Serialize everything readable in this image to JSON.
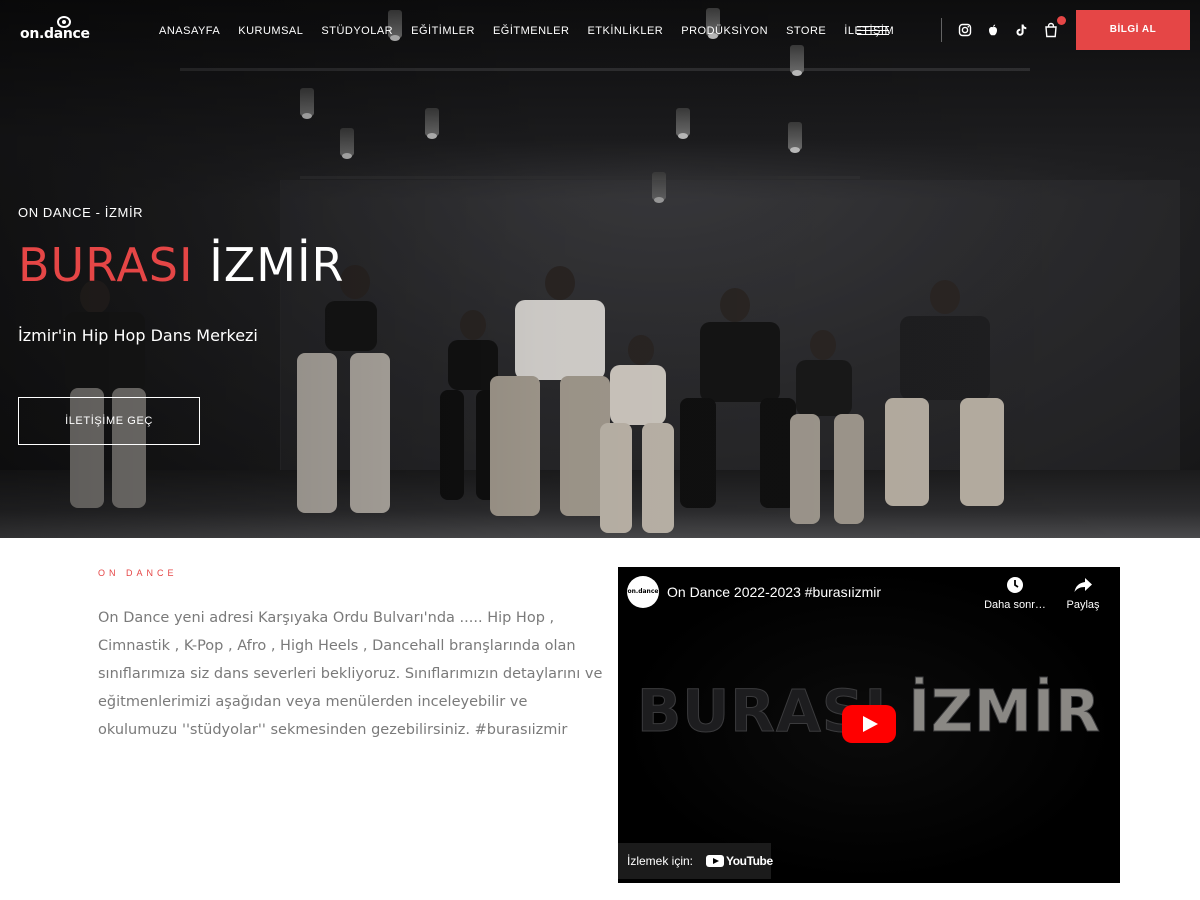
{
  "nav": {
    "logo": "on.dance",
    "menu": [
      "ANASAYFA",
      "KURUMSAL",
      "STÜDYOLAR",
      "EĞİTİMLER",
      "EĞİTMENLER",
      "ETKİNLİKLER",
      "PRODÜKSİYON",
      "STORE",
      "İLETİŞİM"
    ],
    "icons": [
      "menu-icon",
      "instagram-icon",
      "apple-icon",
      "tiktok-icon",
      "cart-icon"
    ],
    "cta_label": "BİLGİ AL"
  },
  "hero": {
    "kicker": "ON DANCE - İZMİR",
    "title_red": "BURASI",
    "title_white": "İZMİR",
    "subtitle": "İzmir'in Hip Hop Dans Merkezi",
    "button_label": "İLETİŞİME GEÇ"
  },
  "about": {
    "kicker": "ON DANCE",
    "text": "On Dance yeni adresi Karşıyaka Ordu Bulvarı'nda ..... Hip Hop , Cimnastik , K-Pop , Afro , High Heels , Dancehall branşlarında olan sınıflarımıza siz dans severleri bekliyoruz. Sınıflarımızın detaylarını ve eğitmenlerimizi aşağıdan veya menülerden inceleyebilir ve okulumuzu ''stüdyolar'' sekmesinden gezebilirsiniz. #burasıizmir"
  },
  "video": {
    "channel_logo": "on.dance",
    "title": "On Dance 2022-2023 #burasıizmir",
    "watch_later": "Daha sonr…",
    "share": "Paylaş",
    "overlay_part1": "BURASI ",
    "overlay_part2": "İZMİR",
    "watch_on": "İzlemek için:",
    "youtube": "YouTube"
  },
  "colors": {
    "accent": "#e54646",
    "body_text": "#7a7a7a",
    "youtube_red": "#ff0000"
  }
}
